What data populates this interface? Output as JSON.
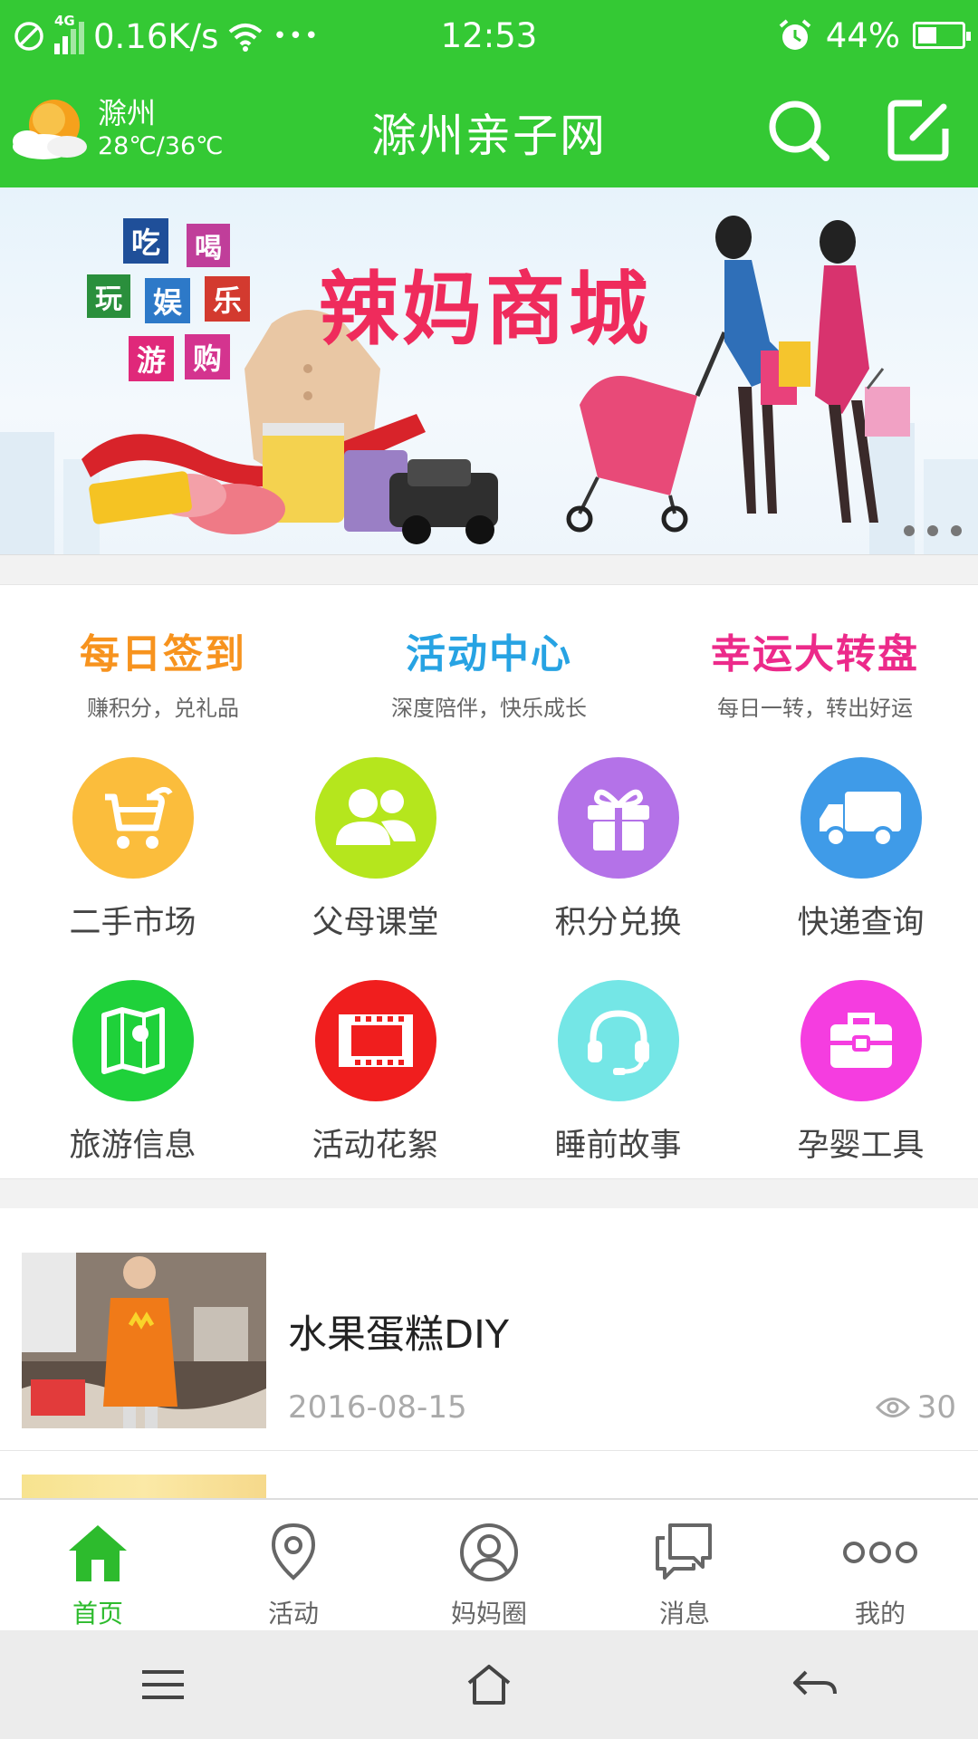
{
  "status_bar": {
    "network": "4G",
    "speed": "0.16K/s",
    "more": "•••",
    "time": "12:53",
    "battery": "44%",
    "battery_level": 0.44
  },
  "header": {
    "city": "滁州",
    "temperature": "28℃/36℃",
    "title": "滁州亲子网",
    "icons": [
      "weather-icon",
      "search-icon",
      "edit-icon"
    ]
  },
  "banner": {
    "title": "辣妈商城",
    "tiles": [
      "吃",
      "喝",
      "玩",
      "娱",
      "乐",
      "游",
      "购"
    ],
    "page_count": 3
  },
  "quick_links": [
    {
      "title": "每日签到",
      "subtitle": "赚积分，兑礼品",
      "color": "#f7931e"
    },
    {
      "title": "活动中心",
      "subtitle": "深度陪伴，快乐成长",
      "color": "#27a3e3"
    },
    {
      "title": "幸运大转盘",
      "subtitle": "每日一转，转出好运",
      "color": "#ec2a8a"
    }
  ],
  "grid": [
    {
      "label": "二手市场",
      "icon": "stroller-icon",
      "color": "#fbbd3c"
    },
    {
      "label": "父母课堂",
      "icon": "parents-icon",
      "color": "#b5e61d"
    },
    {
      "label": "积分兑换",
      "icon": "gift-icon",
      "color": "#b472e8"
    },
    {
      "label": "快递查询",
      "icon": "truck-icon",
      "color": "#3f9be8"
    },
    {
      "label": "旅游信息",
      "icon": "map-icon",
      "color": "#1fd13a"
    },
    {
      "label": "活动花絮",
      "icon": "film-icon",
      "color": "#f01e1e"
    },
    {
      "label": "睡前故事",
      "icon": "headset-icon",
      "color": "#74e6e6"
    },
    {
      "label": "孕婴工具",
      "icon": "toolbox-icon",
      "color": "#f53de0"
    }
  ],
  "articles": [
    {
      "title": "水果蛋糕DIY",
      "date": "2016-08-15",
      "views": "30"
    }
  ],
  "tabbar": [
    {
      "label": "首页",
      "icon": "home-icon",
      "active": true
    },
    {
      "label": "活动",
      "icon": "location-pin-icon",
      "active": false
    },
    {
      "label": "妈妈圈",
      "icon": "user-circle-icon",
      "active": false
    },
    {
      "label": "消息",
      "icon": "chat-icon",
      "active": false
    },
    {
      "label": "我的",
      "icon": "more-dots-icon",
      "active": false
    }
  ],
  "colors": {
    "brand_green": "#34c934",
    "active_tab": "#2dbb2d",
    "banner_title": "#ef2b5c"
  }
}
